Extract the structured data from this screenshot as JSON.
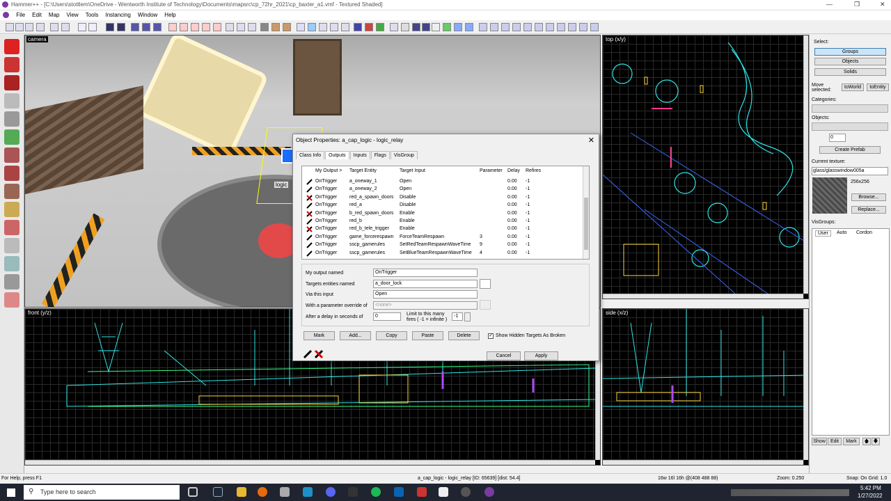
{
  "window": {
    "title": "Hammer++ - [C:\\Users\\stottlem\\OneDrive - Wentworth Institute of Technology\\Documents\\mapsrc\\cp_72hr_2021\\cp_baxter_a1.vmf - Textured Shaded]"
  },
  "menu": [
    "File",
    "Edit",
    "Map",
    "View",
    "Tools",
    "Instancing",
    "Window",
    "Help"
  ],
  "viewports": {
    "camera": "camera",
    "top": "top (x/y)",
    "front": "front (y/z)",
    "side": "side (x/z)",
    "world_label": "logic"
  },
  "dialog": {
    "title": "Object Properties: a_cap_logic - logic_relay",
    "tabs": [
      "Class Info",
      "Outputs",
      "Inputs",
      "Flags",
      "VisGroup"
    ],
    "columns": [
      "My Output  >",
      "Target Entity",
      "Target Input",
      "Parameter",
      "Delay",
      "Refires"
    ],
    "rows": [
      {
        "output": "OnTrigger",
        "target": "a_oneway_1",
        "input": "Open",
        "param": "",
        "delay": "0.00",
        "refires": "-1",
        "broken": false
      },
      {
        "output": "OnTrigger",
        "target": "a_oneway_2",
        "input": "Open",
        "param": "",
        "delay": "0.00",
        "refires": "-1",
        "broken": false
      },
      {
        "output": "OnTrigger",
        "target": "red_a_spawn_doors",
        "input": "Disable",
        "param": "",
        "delay": "0.00",
        "refires": "-1",
        "broken": true
      },
      {
        "output": "OnTrigger",
        "target": "red_a",
        "input": "Disable",
        "param": "",
        "delay": "0.00",
        "refires": "-1",
        "broken": false
      },
      {
        "output": "OnTrigger",
        "target": "b_red_spawn_doors",
        "input": "Enable",
        "param": "",
        "delay": "0.00",
        "refires": "-1",
        "broken": true
      },
      {
        "output": "OnTrigger",
        "target": "red_b",
        "input": "Enable",
        "param": "",
        "delay": "0.00",
        "refires": "-1",
        "broken": false
      },
      {
        "output": "OnTrigger",
        "target": "red_b_tele_trigger",
        "input": "Enable",
        "param": "",
        "delay": "0.00",
        "refires": "-1",
        "broken": true
      },
      {
        "output": "OnTrigger",
        "target": "game_forcerespawn",
        "input": "ForceTeamRespawn",
        "param": "3",
        "delay": "0.00",
        "refires": "-1",
        "broken": false
      },
      {
        "output": "OnTrigger",
        "target": "sscp_gamerules",
        "input": "SetRedTeamRespawnWaveTime",
        "param": "9",
        "delay": "0.00",
        "refires": "-1",
        "broken": false
      },
      {
        "output": "OnTrigger",
        "target": "sscp_gamerules",
        "input": "SetBlueTeamRespawnWaveTime",
        "param": "4",
        "delay": "0.00",
        "refires": "-1",
        "broken": false
      }
    ],
    "labels": {
      "my_output": "My output named",
      "targets": "Targets entities named",
      "via": "Via this input",
      "param_override": "With a parameter override of",
      "delay": "After a delay in seconds of",
      "limit": "Limit to this many fires ( -1 = infinite )",
      "show_hidden": "Show Hidden Targets As Broken"
    },
    "values": {
      "my_output": "OnTrigger",
      "targets": "a_door_lock",
      "via": "Open",
      "param_override": "<none>",
      "delay": "0",
      "limit": "-1"
    },
    "buttons": {
      "mark": "Mark",
      "add": "Add...",
      "copy": "Copy",
      "paste": "Paste",
      "delete": "Delete",
      "cancel": "Cancel",
      "apply": "Apply"
    }
  },
  "right": {
    "select": "Select:",
    "groups": "Groups",
    "objects_btn": "Objects",
    "solids": "Solids",
    "move_selected": "Move selected:",
    "to_world": "toWorld",
    "to_entity": "toEntity",
    "categories": "Categories:",
    "objects": "Objects:",
    "objects_count": "0",
    "create_prefab": "Create Prefab",
    "current_texture": "Current texture:",
    "texture_name": "glass/glasswindow005a",
    "texture_size": "256x256",
    "browse": "Browse...",
    "replace": "Replace...",
    "visgroups": "VisGroups:",
    "vis_tabs": [
      "User",
      "Auto",
      "Cordon"
    ],
    "show": "Show",
    "edit": "Edit",
    "mark": "Mark"
  },
  "status": {
    "help": "For Help, press F1",
    "selection": "a_cap_logic - logic_relay  [ID: 65639]  [dist: 54.4]",
    "size": "16w 16l 16h @(408 488 88)",
    "zoom": "Zoom: 0.250",
    "snap": "Snap: On Grid: 1.0"
  },
  "taskbar": {
    "search": "Type here to search",
    "time": "5:42 PM",
    "date": "1/27/2022"
  }
}
